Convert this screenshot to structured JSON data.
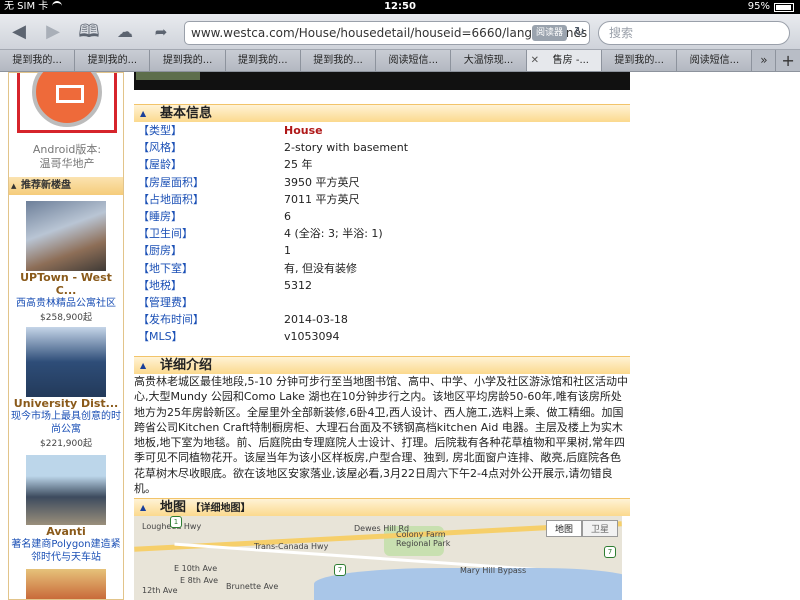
{
  "status": {
    "carrier": "无 SIM 卡",
    "time": "12:50",
    "battery": "95%"
  },
  "browser": {
    "url": "www.westca.com/House/housedetail/houseid=6660/lang=schines",
    "reader_label": "阅读器",
    "search_placeholder": "搜索"
  },
  "tabs": [
    "提到我的...",
    "提到我的...",
    "提到我的...",
    "提到我的...",
    "提到我的...",
    "阅读短信...",
    "大温惊现...",
    "售房 -...",
    "提到我的...",
    "阅读短信..."
  ],
  "tab_more": "»",
  "tab_add": "+",
  "sidebar": {
    "android_label": "Android版本:",
    "site_name": "温哥华地产",
    "rec_title": "推荐新楼盘",
    "listings": [
      {
        "title": "UPTown - West C...",
        "desc": "西高贵林精品公寓社区",
        "price": "$258,900起"
      },
      {
        "title": "University Dist...",
        "desc": "现今市场上最具创意的时尚公寓",
        "price": "$221,900起"
      },
      {
        "title": "Avanti",
        "desc": "著名建商Polygon建造紧邻时代与天车站",
        "price": ""
      }
    ]
  },
  "basic_info": {
    "heading": "基本信息",
    "rows": [
      {
        "key": "【类型】",
        "value": "House",
        "highlight": true
      },
      {
        "key": "【风格】",
        "value": "2-story with basement"
      },
      {
        "key": "【屋龄】",
        "value": "25 年"
      },
      {
        "key": "【房屋面积】",
        "value": "3950 平方英尺"
      },
      {
        "key": "【占地面积】",
        "value": "7011 平方英尺"
      },
      {
        "key": "【睡房】",
        "value": "6"
      },
      {
        "key": "【卫生间】",
        "value": "4 (全浴: 3; 半浴: 1)"
      },
      {
        "key": "【厨房】",
        "value": "1"
      },
      {
        "key": "【地下室】",
        "value": "有, 但没有装修"
      },
      {
        "key": "【地税】",
        "value": "5312"
      },
      {
        "key": "【管理费】",
        "value": ""
      },
      {
        "key": "【发布时间】",
        "value": "2014-03-18"
      },
      {
        "key": "【MLS】",
        "value": "v1053094"
      }
    ]
  },
  "detail": {
    "heading": "详细介绍",
    "text": "高贵林老城区最佳地段,5-10 分钟可步行至当地图书馆、高中、中学、小学及社区游泳馆和社区活动中心,大型Mundy 公园和Como Lake 湖也在10分钟步行之内。该地区平均房龄50-60年,唯有该房所处地方为25年房龄新区。全屋里外全部新装修,6卧4卫,西人设计、西人施工,选料上乘、做工精细。加国跨省公司Kitchen Craft特制橱房柜、大理石台面及不锈钢高档kitchen Aid 电器。主层及楼上为实木地板,地下室为地毯。前、后庭院由专理庭院人士设计、打理。后院栽有各种花草植物和平果树,常年四季可见不同植物花开。该屋当年为该小区样板房,户型合理、独到, 房北面窗户连排、敞亮,后庭院各色花草树木尽收眼底。欲在该地区安家落业,该屋必看,3月22日周六下午2-4点对外公开展示,请勿错良机。"
  },
  "map_section": {
    "heading": "地图",
    "link": "【详细地图】",
    "btn_map": "地图",
    "btn_satellite": "卫星",
    "labels": [
      "Dewes Hill Rd",
      "Colony Farm Regional Park",
      "Trans-Canada Hwy",
      "Mary Hill Bypass",
      "E 10th Ave",
      "E 8th Ave",
      "12th Ave",
      "Brunette Ave",
      "Lougheed Hwy"
    ],
    "shields": [
      "1",
      "7",
      "7"
    ]
  }
}
